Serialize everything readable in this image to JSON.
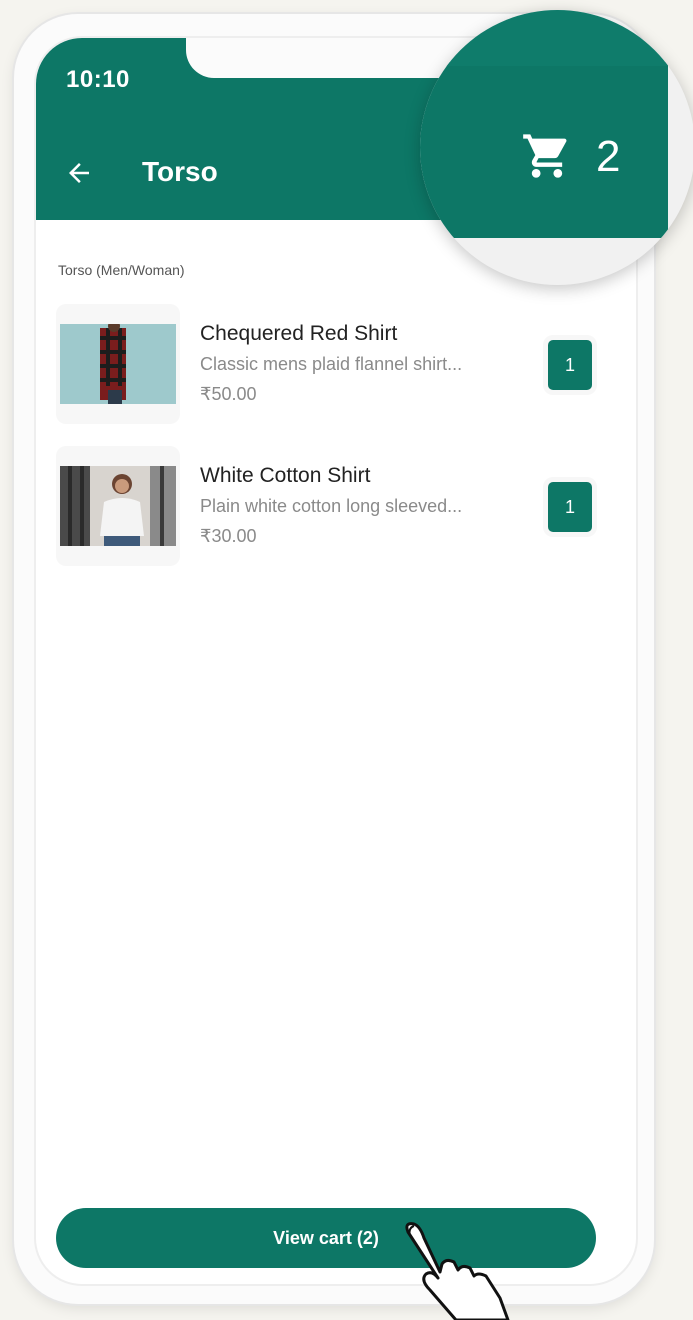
{
  "status_bar": {
    "time": "10:10"
  },
  "app_bar": {
    "title": "Torso",
    "back_icon": "arrow-left-icon"
  },
  "section": {
    "label": "Torso (Men/Woman)"
  },
  "products": [
    {
      "name": "Chequered Red Shirt",
      "description": "Classic mens plaid flannel shirt...",
      "price": "₹50.00",
      "quantity": "1"
    },
    {
      "name": "White Cotton Shirt",
      "description": "Plain white cotton long sleeved...",
      "price": "₹30.00",
      "quantity": "1"
    }
  ],
  "cart_button": {
    "label": "View cart (2)"
  },
  "magnifier": {
    "cart_icon": "shopping-cart-icon",
    "cart_count": "2"
  },
  "colors": {
    "primary": "#0d7766",
    "background": "#f5f4ef"
  }
}
